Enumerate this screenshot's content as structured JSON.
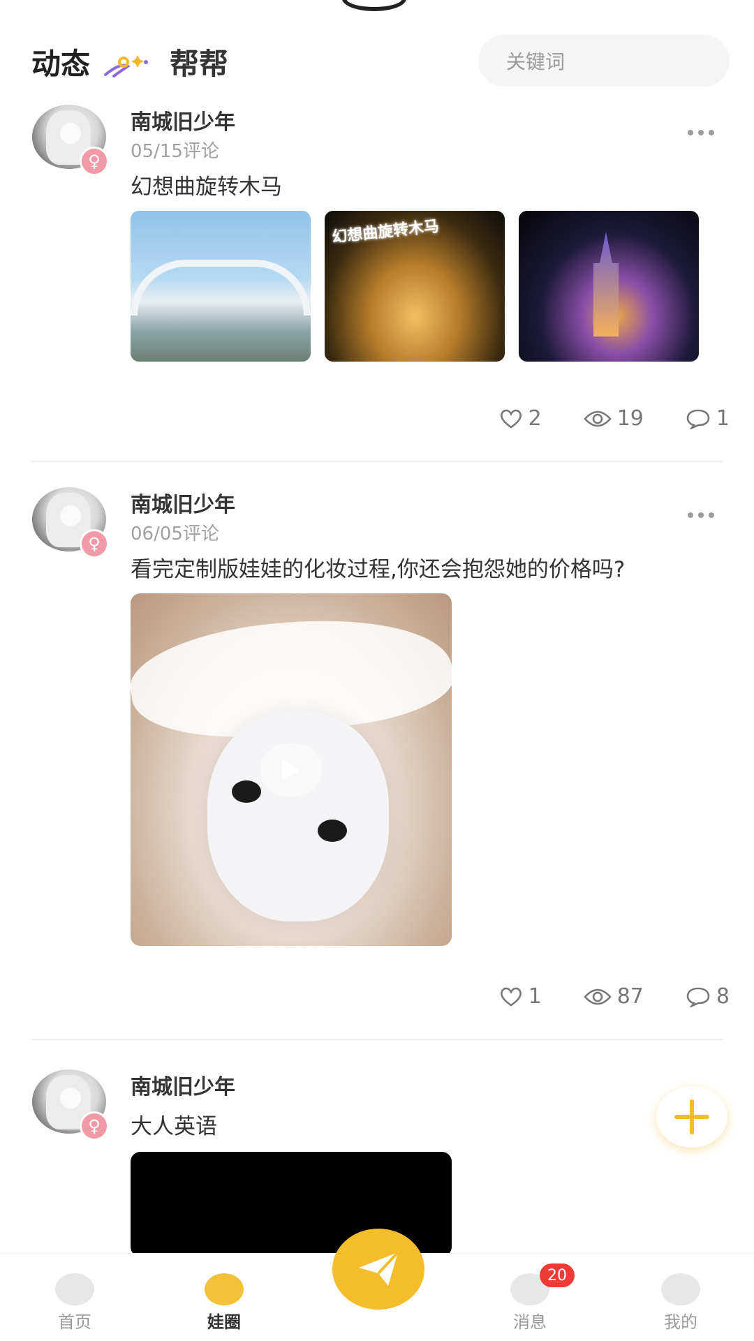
{
  "header": {
    "tabs": [
      {
        "label": "动态"
      },
      {
        "label": "帮帮"
      }
    ],
    "search": {
      "placeholder": "关键词"
    }
  },
  "posts": [
    {
      "username": "南城旧少年",
      "date": "05/15评论",
      "text": "幻想曲旋转木马",
      "images": [
        "stadium-photo",
        "carousel-photo",
        "castle-photo"
      ],
      "image_sign": "幻想曲旋转木马",
      "likes": "2",
      "views": "19",
      "comments": "1"
    },
    {
      "username": "南城旧少年",
      "date": "06/05评论",
      "text": "看完定制版娃娃的化妆过程,你还会抱怨她的价格吗?",
      "likes": "1",
      "views": "87",
      "comments": "8"
    },
    {
      "username": "南城旧少年",
      "text": "大人英语"
    }
  ],
  "nav": {
    "items": [
      {
        "label": "首页",
        "icon": "home-icon"
      },
      {
        "label": "娃圈",
        "icon": "planet-icon"
      },
      {
        "label": "消息",
        "icon": "message-icon"
      },
      {
        "label": "我的",
        "icon": "profile-icon"
      }
    ],
    "message_badge": "20"
  },
  "colors": {
    "accent": "#f5bd2c",
    "badge": "#ee3b36",
    "female": "#f19aa6"
  }
}
